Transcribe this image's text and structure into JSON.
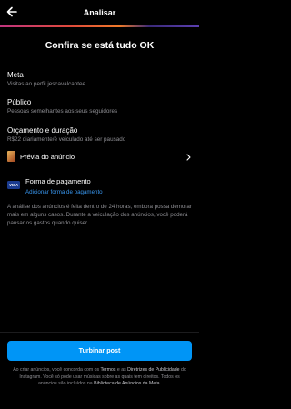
{
  "header": {
    "title": "Analisar"
  },
  "colors": {
    "accent": "#0095f6",
    "link": "#3897f0",
    "muted": "#8e8e93"
  },
  "heading": "Confira se está tudo OK",
  "goal": {
    "title": "Meta",
    "value": "Visitas ao perfil jescavalcantee"
  },
  "audience": {
    "title": "Público",
    "value": "Pessoas semelhantes aos seus seguidores"
  },
  "budget": {
    "title": "Orçamento e duração",
    "value": "R$22 diariamente/é veiculado até ser pausado"
  },
  "preview": {
    "label": "Prévia do anúncio"
  },
  "payment": {
    "icon": "visa-card-icon",
    "badge": "VISA",
    "title": "Forma de pagamento",
    "link": "Adicionar forma de pagamento"
  },
  "info_text": "A análise dos anúncios é feita dentro de 24 horas, embora possa demorar mais em alguns casos. Durante a veiculação dos anúncios, você poderá pausar os gastos quando quiser.",
  "button": {
    "label": "Turbinar post"
  },
  "footer": {
    "part1": "Ao criar anúncios, você concorda com os ",
    "terms": "Termos",
    "part2": " e as ",
    "guidelines": "Diretrizes de Publicidade",
    "part3": " do Instagram. Você só pode usar músicas sobre as quais tem direitos. Todos os anúncios são incluídos na ",
    "library": "Biblioteca de Anúncios da Meta",
    "part4": "."
  }
}
